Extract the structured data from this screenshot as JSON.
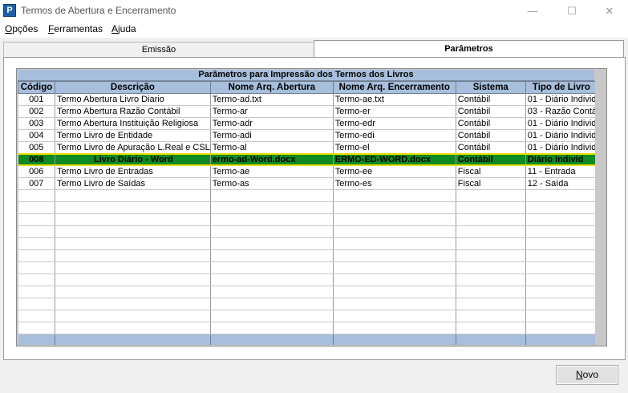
{
  "window": {
    "title": "Termos de Abertura e Encerramento",
    "icon": "P"
  },
  "window_controls": {
    "minimize": "—",
    "maximize": "☐",
    "close": "✕"
  },
  "menu": [
    "Opções",
    "Ferramentas",
    "Ajuda"
  ],
  "tabs": {
    "emissao": "Emissão",
    "parametros": "Parâmetros"
  },
  "grid": {
    "caption": "Parâmetros para Impressão dos Termos dos Livros",
    "columns": [
      "Código",
      "Descrição",
      "Nome  Arq. Abertura",
      "Nome Arq. Encerramento",
      "Sistema",
      "Tipo de Livro"
    ],
    "rows": [
      [
        "001",
        "Termo Abertura Livro Diario",
        "Termo-ad.txt",
        "Termo-ae.txt",
        "Contábil",
        "01 - Diário Individ"
      ],
      [
        "002",
        "Termo Abertura Razão Contábil",
        "Termo-ar",
        "Termo-er",
        "Contábil",
        "03 - Razão Contá"
      ],
      [
        "003",
        "Termo Abertura Instituição Religiosa",
        "Termo-adr",
        "Termo-edr",
        "Contábil",
        "01 - Diário Individ"
      ],
      [
        "004",
        "Termo Livro de Entidade",
        "Termo-adi",
        "Termo-edi",
        "Contábil",
        "01 - Diário Individ"
      ],
      [
        "005",
        "Termo Livro de Apuração L.Real e CSL",
        "Termo-al",
        "Termo-el",
        "Contábil",
        "01 - Diário Individ"
      ],
      [
        "008",
        "Livro Diário - Word",
        "ermo-ad-Word.docx",
        "ERMO-ED-WORD.docx",
        "Contábil",
        "Diário Individ"
      ],
      [
        "006",
        "Termo Livro de Entradas",
        "Termo-ae",
        "Termo-ee",
        "Fiscal",
        "11 - Entrada"
      ],
      [
        "007",
        "Termo Livro de Saídas",
        "Termo-as",
        "Termo-es",
        "Fiscal",
        "12 - Saída"
      ]
    ],
    "selected_row_index": 5,
    "empty_rows": 12
  },
  "buttons": {
    "novo": "Novo"
  }
}
